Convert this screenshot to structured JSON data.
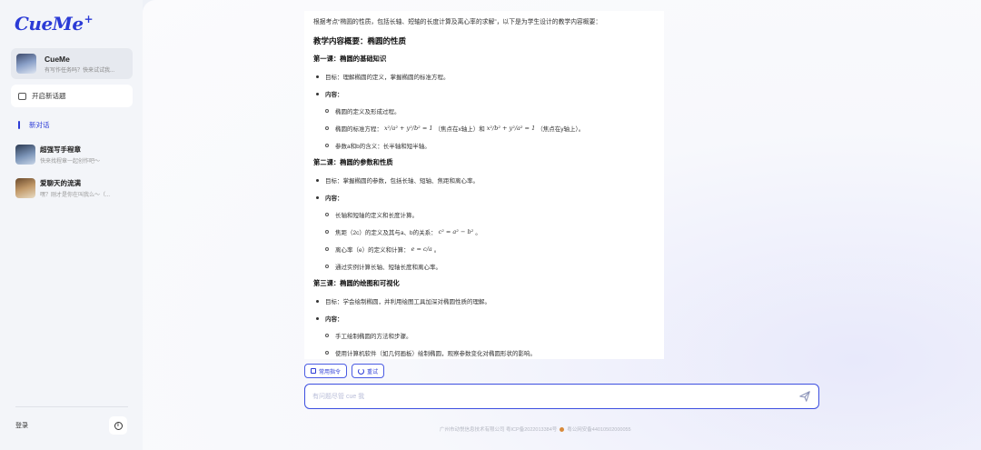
{
  "sidebar": {
    "logo": "CueMe",
    "logo_plus": "+",
    "profile": {
      "name": "CueMe",
      "subtitle": "有写作任务吗？快来试试我..."
    },
    "new_topic_label": "开启新话题",
    "new_chat_label": "新对话",
    "chats": [
      {
        "name": "超强写手程章",
        "subtitle": "快来找程章一起创作吧～"
      },
      {
        "name": "爱聊天的流满",
        "subtitle": "嘿？刚才是你在叫我么～（..."
      }
    ],
    "login_label": "登录",
    "info_icon": "i"
  },
  "content": {
    "intro": "根据考点“椭圆的性质，包括长轴、短轴的长度计算及离心率的求解”，以下是为学生设计的教学内容概要：",
    "title": "教学内容概要：椭圆的性质",
    "lessons": [
      {
        "heading": "第一课：椭圆的基础知识",
        "goal": "目标：理解椭圆的定义，掌握椭圆的标准方程。",
        "content_label": "内容：",
        "items": [
          "椭圆的定义及形成过程。",
          "椭圆的标准方程：",
          "参数a和b的含义：长半轴和短半轴。"
        ],
        "eq1": "x²/a² + y²/b² = 1",
        "eq1_note": "（焦点在x轴上）和",
        "eq2": "x²/b² + y²/a² = 1",
        "eq2_note": "（焦点在y轴上）。"
      },
      {
        "heading": "第二课：椭圆的参数和性质",
        "goal": "目标：掌握椭圆的参数，包括长轴、短轴、焦距和离心率。",
        "content_label": "内容：",
        "items": [
          "长轴和短轴的定义和长度计算。",
          "焦距（2c）的定义及其与a、b的关系：",
          "离心率（e）的定义和计算：",
          "通过实例计算长轴、短轴长度和离心率。"
        ],
        "eq_c": "c² = a² − b²",
        "eq_e": "e = c/a"
      },
      {
        "heading": "第三课：椭圆的绘图和可视化",
        "goal": "目标：学会绘制椭圆，并利用绘图工具加深对椭圆性质的理解。",
        "content_label": "内容：",
        "items": [
          "手工绘制椭圆的方法和步骤。",
          "使用计算机软件（如几何画板）绘制椭圆，观察参数变化对椭圆形状的影响。"
        ]
      }
    ]
  },
  "actions": {
    "common_commands": "常用指令",
    "retry": "重试"
  },
  "input": {
    "placeholder": "有问题尽管 cue 我"
  },
  "footer": {
    "icp": "广州市动悦信息技术有限公司 粤ICP备2022013384号",
    "police": "粤公网安备44010502000055"
  },
  "colors": {
    "accent": "#2b3bd6",
    "sidebar_bg": "#f3f5f9"
  }
}
